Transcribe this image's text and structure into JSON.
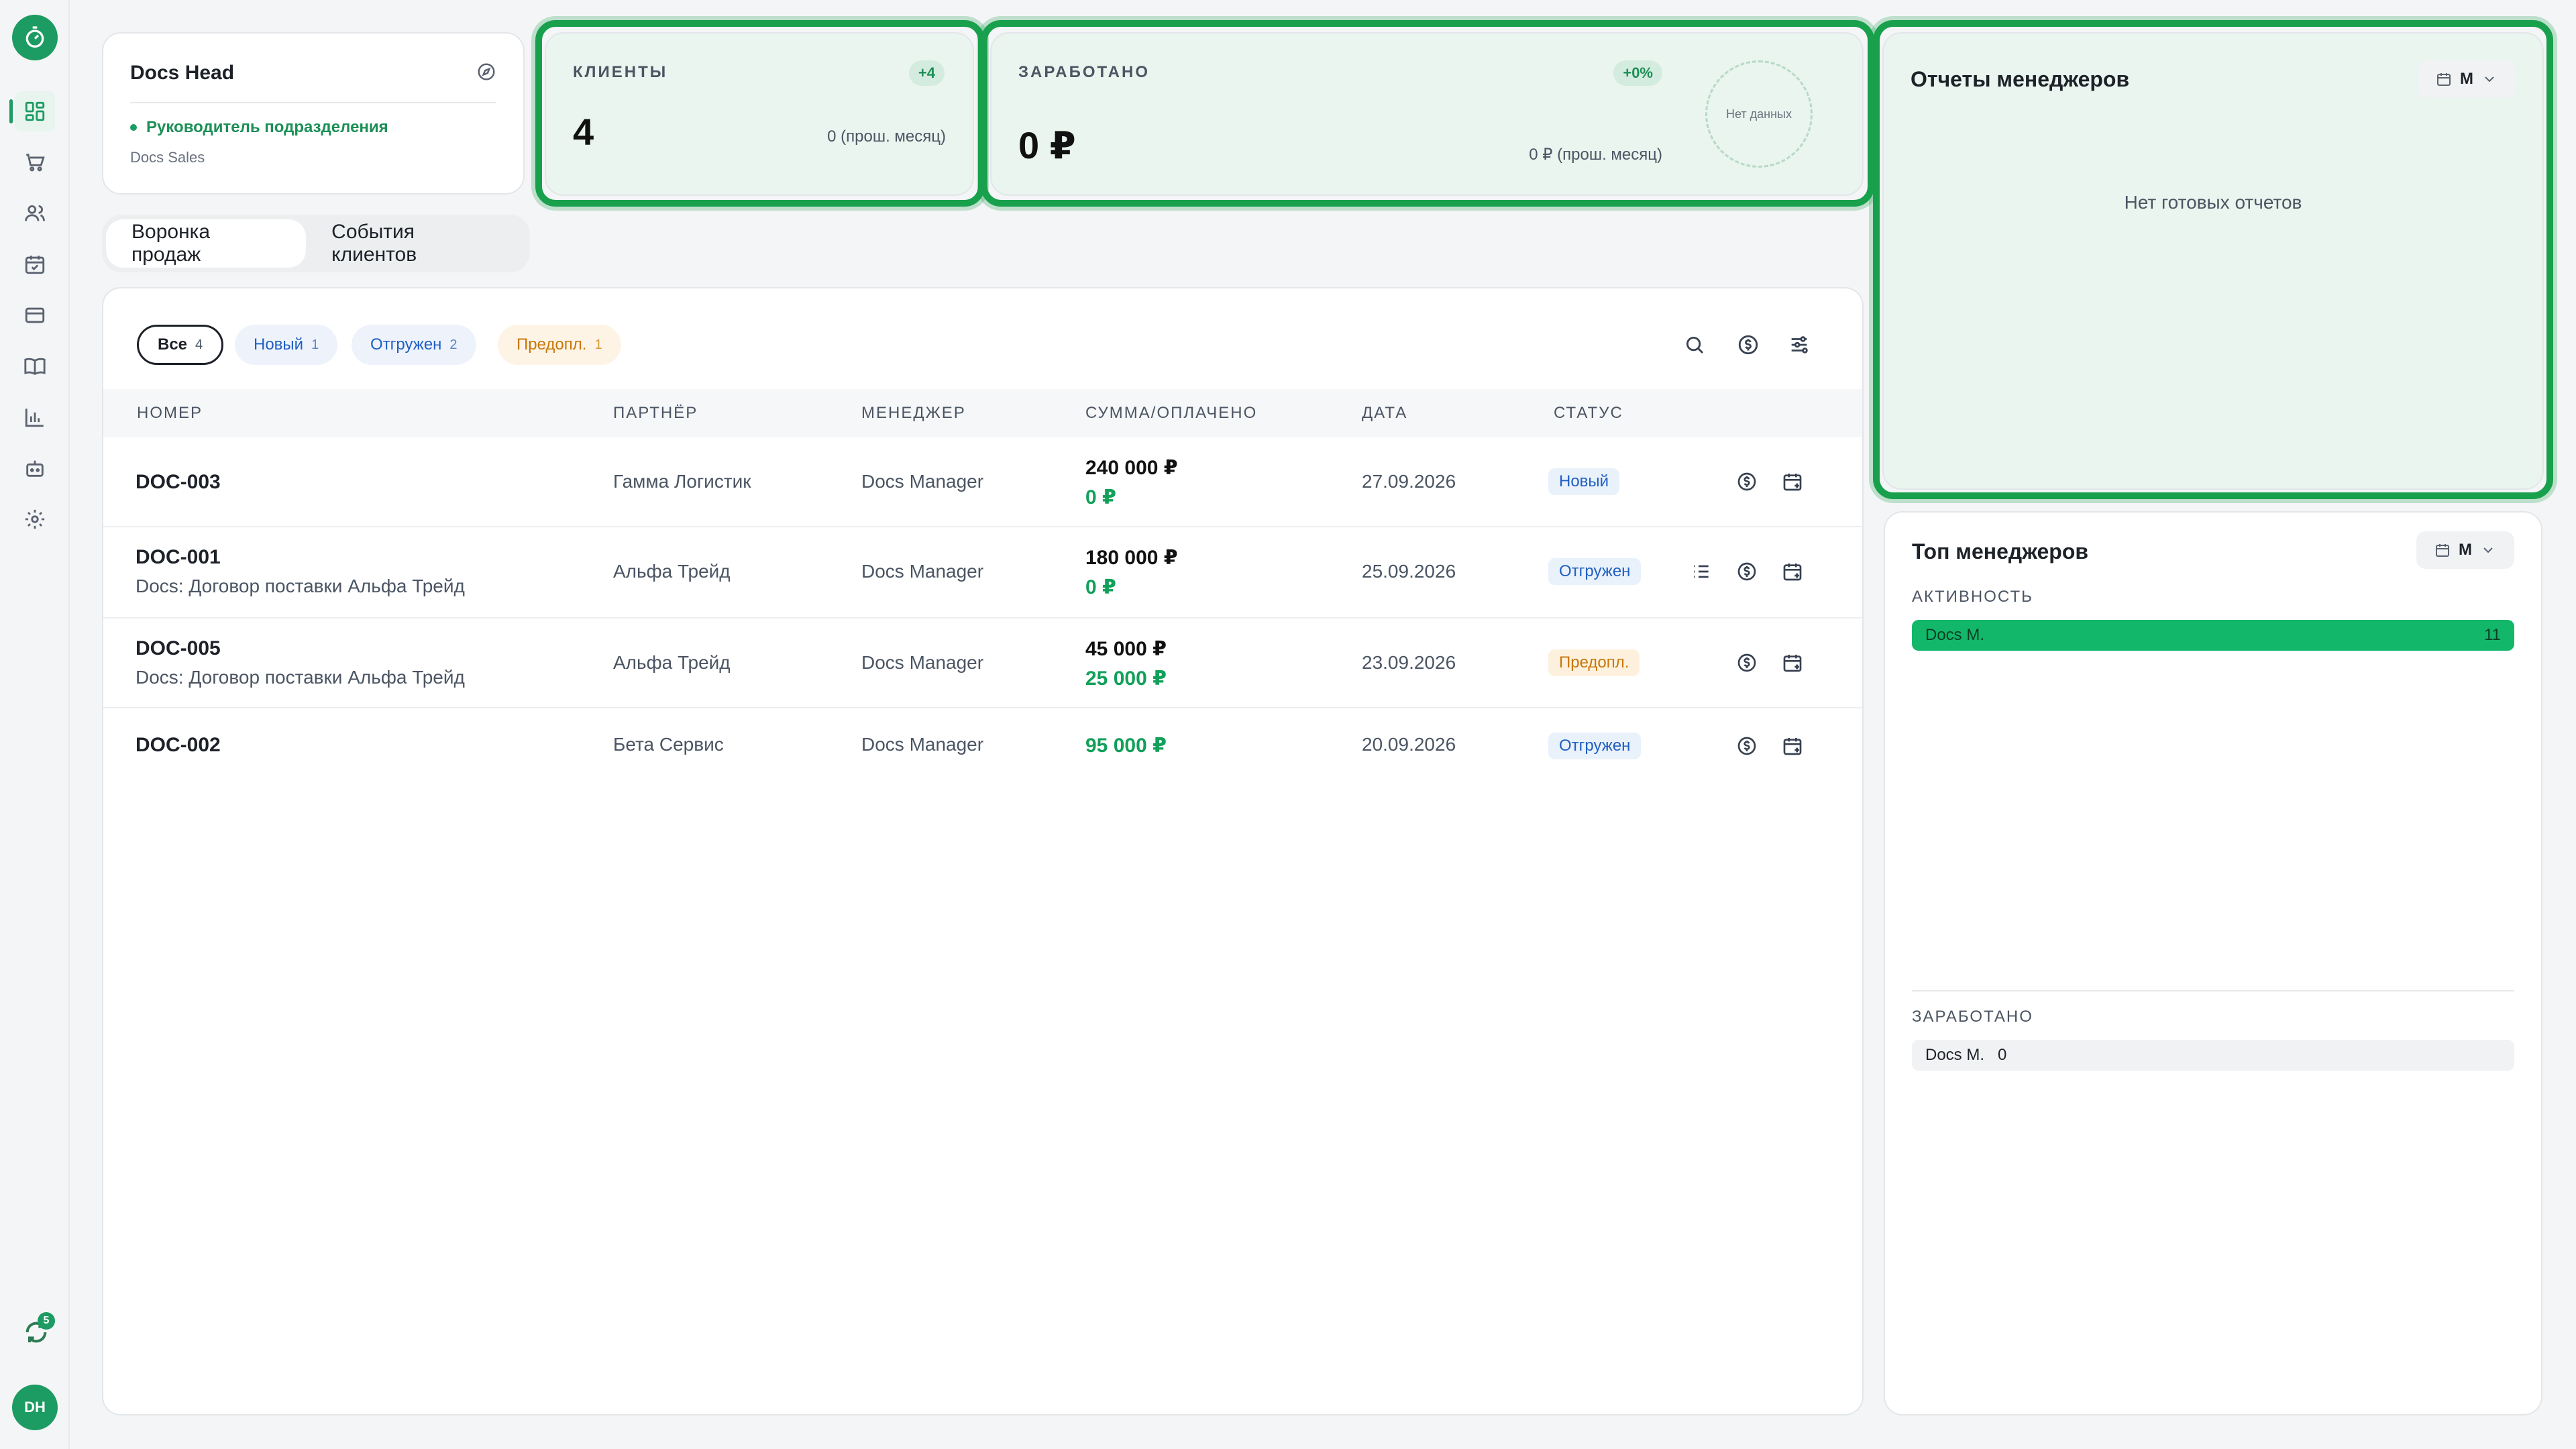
{
  "sidebar": {
    "nav": [
      "dashboard",
      "orders",
      "clients",
      "calendar",
      "payments",
      "catalog",
      "analytics",
      "bots",
      "settings"
    ],
    "sync_count": "5",
    "avatar_initials": "DH"
  },
  "profile": {
    "name": "Docs Head",
    "role": "Руководитель подразделения",
    "department": "Docs Sales"
  },
  "clients_card": {
    "label": "КЛИЕНТЫ",
    "badge": "+4",
    "value": "4",
    "prev": "0 (прош. месяц)"
  },
  "earned_card": {
    "label": "ЗАРАБОТАНО",
    "badge": "+0%",
    "value": "0 ₽",
    "prev": "0 ₽ (прош. месяц)",
    "no_data": "Нет данных"
  },
  "reports_panel": {
    "title": "Отчеты менеджеров",
    "period": "М",
    "empty": "Нет готовых отчетов"
  },
  "top_managers": {
    "title": "Топ менеджеров",
    "period": "М",
    "activity_label": "АКТИВНОСТЬ",
    "activity": {
      "name": "Docs M.",
      "value": "11"
    },
    "earned_label": "ЗАРАБОТАНО",
    "earned": {
      "name": "Docs M.",
      "value": "0"
    }
  },
  "tabs": [
    "Воронка продаж",
    "События клиентов"
  ],
  "filters": [
    {
      "label": "Все",
      "count": "4"
    },
    {
      "label": "Новый",
      "count": "1"
    },
    {
      "label": "Отгружен",
      "count": "2"
    },
    {
      "label": "Предопл.",
      "count": "1"
    }
  ],
  "table": {
    "headers": [
      "НОМЕР",
      "ПАРТНЁР",
      "МЕНЕДЖЕР",
      "СУММА/ОПЛАЧЕНО",
      "ДАТА",
      "СТАТУС"
    ],
    "rows": [
      {
        "num": "DOC-003",
        "sub": "",
        "partner": "Гамма Логистик",
        "manager": "Docs Manager",
        "amount": "240 000 ₽",
        "paid": "0 ₽",
        "date": "27.09.2026",
        "status": "Новый"
      },
      {
        "num": "DOC-001",
        "sub": "Docs: Договор поставки Альфа Трейд",
        "partner": "Альфа Трейд",
        "manager": "Docs Manager",
        "amount": "180 000 ₽",
        "paid": "0 ₽",
        "date": "25.09.2026",
        "status": "Отгружен"
      },
      {
        "num": "DOC-005",
        "sub": "Docs: Договор поставки Альфа Трейд",
        "partner": "Альфа Трейд",
        "manager": "Docs Manager",
        "amount": "45 000 ₽",
        "paid": "25 000 ₽",
        "date": "23.09.2026",
        "status": "Предопл."
      },
      {
        "num": "DOC-002",
        "sub": "",
        "partner": "Бета Сервис",
        "manager": "Docs Manager",
        "amount": "",
        "paid": "95 000 ₽",
        "date": "20.09.2026",
        "status": "Отгружен"
      }
    ]
  }
}
